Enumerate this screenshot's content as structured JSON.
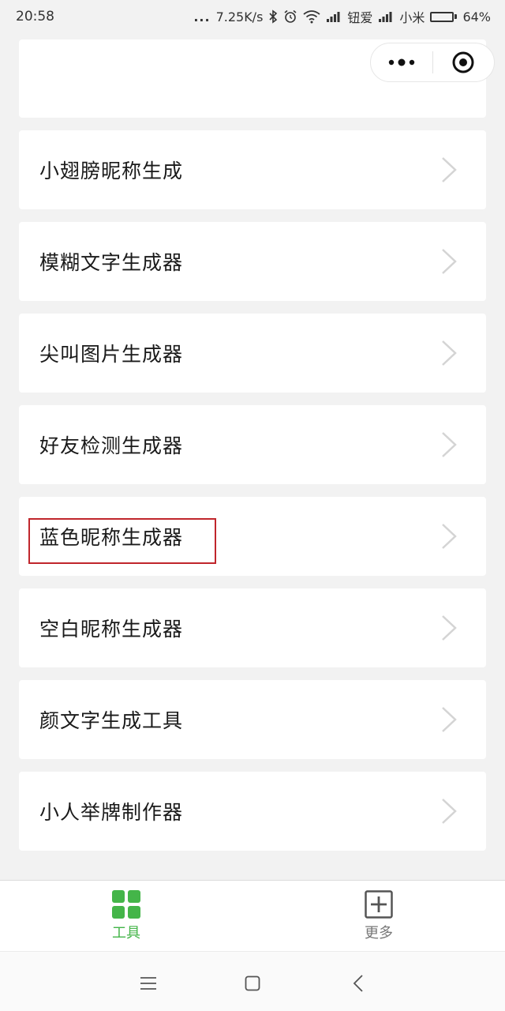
{
  "status_bar": {
    "time": "20:58",
    "dots": "...",
    "net_speed": "7.25K/s",
    "carrier1": "钮爱",
    "carrier2": "小米",
    "battery_level": 0.64,
    "battery_percent": "64%",
    "icons": [
      "bluetooth-icon",
      "alarm-icon",
      "wifi-icon",
      "signal-icon",
      "battery-icon"
    ]
  },
  "capsule": {
    "icons": [
      "more-dots-icon",
      "close-target-icon"
    ]
  },
  "list": {
    "items": [
      {
        "label": ""
      },
      {
        "label": "小翅膀昵称生成"
      },
      {
        "label": "模糊文字生成器"
      },
      {
        "label": "尖叫图片生成器"
      },
      {
        "label": "好友检测生成器"
      },
      {
        "label": "蓝色昵称生成器"
      },
      {
        "label": "空白昵称生成器"
      },
      {
        "label": "颜文字生成工具"
      },
      {
        "label": "小人举牌制作器"
      }
    ],
    "highlighted_item": "蓝色昵称生成器"
  },
  "tabbar": {
    "tabs": [
      {
        "label": "工具",
        "icon": "grid-icon",
        "active": true
      },
      {
        "label": "更多",
        "icon": "plus-square-icon",
        "active": false
      }
    ]
  },
  "colors": {
    "accent": "#44b549",
    "highlight_border": "#c0262c",
    "background": "#f2f2f2"
  },
  "navbar": {
    "icons": [
      "menu-icon",
      "home-icon",
      "back-icon"
    ]
  }
}
